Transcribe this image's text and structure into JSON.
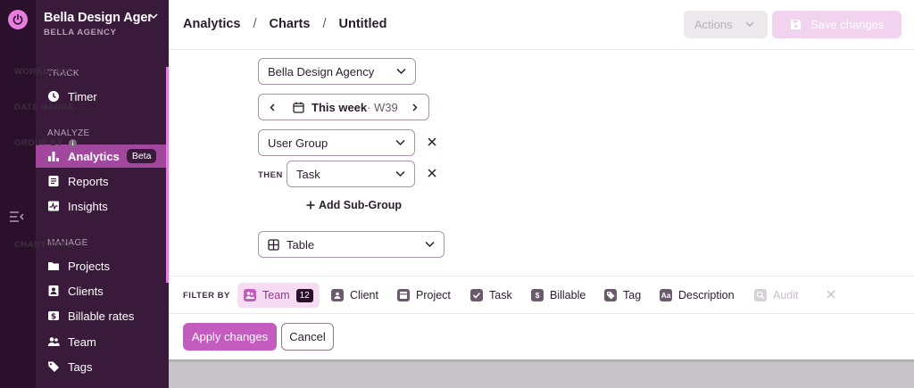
{
  "colors": {
    "rail": "#2b102c",
    "sidebar": "#3a1a3b",
    "active": "#a2479e",
    "accent": "#e97de0",
    "primary": "#c45cbf"
  },
  "workspace": {
    "name": "Bella Design Agency",
    "subtitle": "BELLA AGENCY"
  },
  "sidebar": {
    "sections": [
      {
        "title": "TRACK"
      },
      {
        "title": "ANALYZE"
      },
      {
        "title": "MANAGE"
      }
    ],
    "items": [
      {
        "label": "Timer",
        "icon": "clock-icon"
      },
      {
        "label": "Analytics",
        "icon": "bar-chart-icon",
        "badge": "Beta",
        "active": true
      },
      {
        "label": "Reports",
        "icon": "report-icon"
      },
      {
        "label": "Insights",
        "icon": "insights-icon"
      },
      {
        "label": "Projects",
        "icon": "folder-icon"
      },
      {
        "label": "Clients",
        "icon": "client-icon"
      },
      {
        "label": "Billable rates",
        "icon": "dollar-icon"
      },
      {
        "label": "Team",
        "icon": "team-icon"
      },
      {
        "label": "Tags",
        "icon": "tag-icon"
      }
    ]
  },
  "header": {
    "breadcrumbs": [
      "Analytics",
      "Charts",
      "Untitled"
    ],
    "separator": "/",
    "actions_label": "Actions",
    "save_label": "Save changes"
  },
  "form": {
    "workspace": {
      "label": "WORKSPACE",
      "value": "Bella Design Agency"
    },
    "date_range": {
      "label": "DATE RANGE",
      "value": "This week",
      "week": "· W39"
    },
    "group_by": {
      "label": "GROUP BY",
      "value": "User Group",
      "then_label": "THEN",
      "then_value": "Task",
      "add_label": "Add Sub-Group"
    },
    "chart_type": {
      "label": "CHART TYPE",
      "value": "Table"
    }
  },
  "filters": {
    "label": "FILTER BY",
    "items": [
      {
        "label": "Team",
        "icon": "team-icon",
        "count": "12",
        "active": true
      },
      {
        "label": "Client",
        "icon": "client-icon"
      },
      {
        "label": "Project",
        "icon": "project-icon"
      },
      {
        "label": "Task",
        "icon": "task-check-icon"
      },
      {
        "label": "Billable",
        "icon": "dollar-icon"
      },
      {
        "label": "Tag",
        "icon": "tag-icon"
      },
      {
        "label": "Description",
        "icon": "description-icon",
        "glyph": "Aa"
      },
      {
        "label": "Audit",
        "icon": "audit-icon",
        "disabled": true
      }
    ]
  },
  "footer": {
    "apply_label": "Apply changes",
    "cancel_label": "Cancel"
  }
}
